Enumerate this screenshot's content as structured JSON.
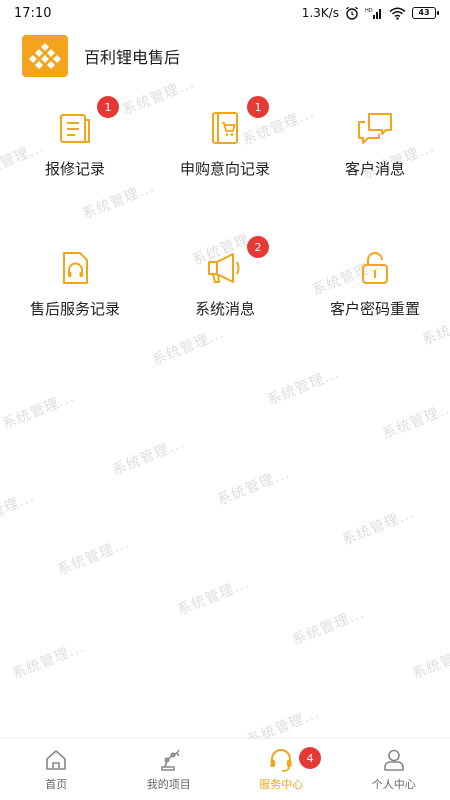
{
  "status_bar": {
    "time": "17:10",
    "net_speed": "1.3K/s",
    "battery": "43",
    "icons": [
      "alarm-icon",
      "hd-signal-icon",
      "wifi-icon",
      "battery-icon"
    ]
  },
  "header": {
    "title": "百利锂电售后",
    "logo_icon": "diamond-grid-logo"
  },
  "grid": [
    {
      "label": "报修记录",
      "icon": "repair-record-icon",
      "badge": "1"
    },
    {
      "label": "申购意向记录",
      "icon": "purchase-intent-icon",
      "badge": "1"
    },
    {
      "label": "客户消息",
      "icon": "chat-bubbles-icon",
      "badge": ""
    },
    {
      "label": "售后服务记录",
      "icon": "service-record-icon",
      "badge": ""
    },
    {
      "label": "系统消息",
      "icon": "megaphone-icon",
      "badge": "2"
    },
    {
      "label": "客户密码重置",
      "icon": "unlock-icon",
      "badge": ""
    }
  ],
  "watermark_text": "系统管理...",
  "bottom_nav": {
    "items": [
      {
        "label": "首页",
        "icon": "home-icon",
        "active": false
      },
      {
        "label": "我的项目",
        "icon": "robot-arm-icon",
        "active": false
      },
      {
        "label": "服务中心",
        "icon": "headset-icon",
        "active": true,
        "badge": "4"
      },
      {
        "label": "个人中心",
        "icon": "person-icon",
        "active": false
      }
    ]
  },
  "colors": {
    "accent": "#f2a51c",
    "badge": "#e53935",
    "text": "#222222"
  }
}
